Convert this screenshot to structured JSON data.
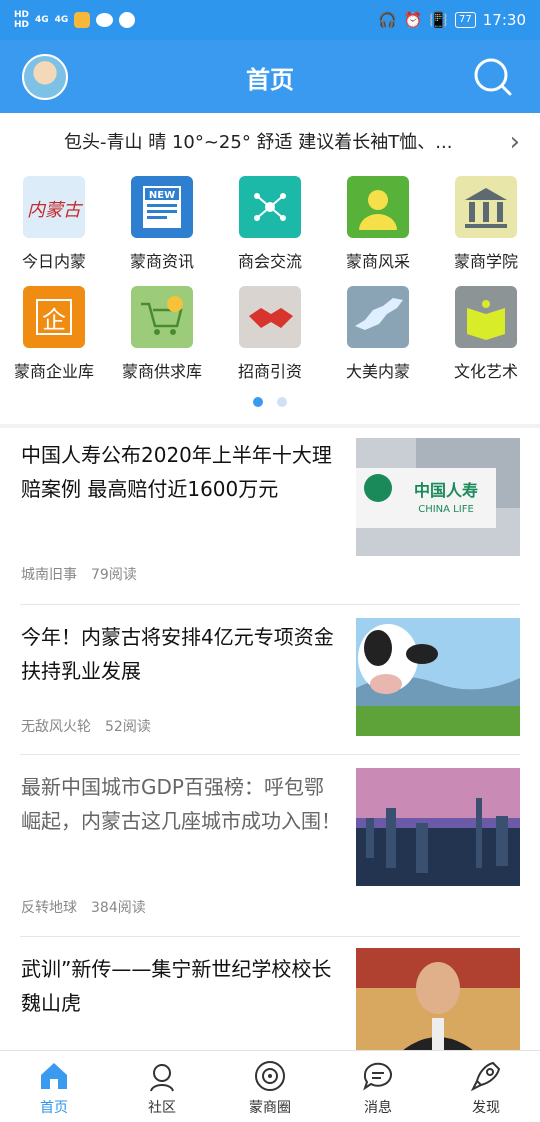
{
  "status_bar": {
    "left_text": "HD",
    "network": "4G",
    "time": "17:30",
    "battery": "77"
  },
  "header": {
    "title": "首页"
  },
  "weather": {
    "text": "包头-青山 晴 10°~25° 舒适 建议着长袖T恤、..."
  },
  "categories": [
    {
      "label": "今日内蒙",
      "icon": "inner-mongolia-logo-icon",
      "color": "#dcecf8"
    },
    {
      "label": "蒙商资讯",
      "icon": "news-icon",
      "color": "#2f7fd1"
    },
    {
      "label": "商会交流",
      "icon": "network-icon",
      "color": "#1cb8a8"
    },
    {
      "label": "蒙商风采",
      "icon": "person-icon",
      "color": "#58b23a"
    },
    {
      "label": "蒙商学院",
      "icon": "academy-icon",
      "color": "#e8e6a8"
    },
    {
      "label": "蒙商企业库",
      "icon": "enterprise-icon",
      "color": "#f08c12"
    },
    {
      "label": "蒙商供求库",
      "icon": "cart-icon",
      "color": "#9ccc7a"
    },
    {
      "label": "招商引资",
      "icon": "handshake-icon",
      "color": "#d9d4d0"
    },
    {
      "label": "大美内蒙",
      "icon": "map-icon",
      "color": "#8aa3b5"
    },
    {
      "label": "文化艺术",
      "icon": "book-icon",
      "color": "#8c9496"
    }
  ],
  "pager": {
    "count": 2,
    "active": 0
  },
  "news": [
    {
      "title": "中国人寿公布2020年上半年十大理赔案例 最高赔付近1600万元",
      "source": "城南旧事",
      "reads": "79阅读",
      "image": "china-life-building"
    },
    {
      "title": "今年！内蒙古将安排4亿元专项资金扶持乳业发展",
      "source": "无敌风火轮",
      "reads": "52阅读",
      "image": "cow-grassland"
    },
    {
      "title": "最新中国城市GDP百强榜：呼包鄂崛起，内蒙古这几座城市成功入围！",
      "source": "反转地球",
      "reads": "384阅读",
      "image": "city-skyline"
    },
    {
      "title": "武训”新传——集宁新世纪学校校长魏山虎",
      "source": "",
      "reads": "",
      "image": "man-portrait"
    }
  ],
  "tabs": [
    {
      "label": "首页",
      "icon": "home-icon",
      "active": true
    },
    {
      "label": "社区",
      "icon": "community-icon",
      "active": false
    },
    {
      "label": "蒙商圈",
      "icon": "circle-icon",
      "active": false
    },
    {
      "label": "消息",
      "icon": "message-icon",
      "active": false
    },
    {
      "label": "发现",
      "icon": "rocket-icon",
      "active": false
    }
  ]
}
